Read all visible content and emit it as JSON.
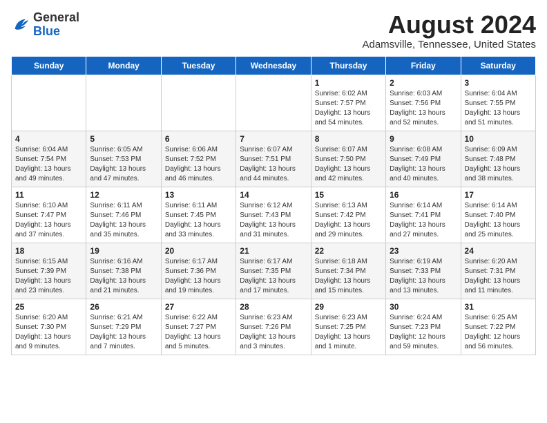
{
  "header": {
    "logo_general": "General",
    "logo_blue": "Blue",
    "month_title": "August 2024",
    "location": "Adamsville, Tennessee, United States"
  },
  "days_of_week": [
    "Sunday",
    "Monday",
    "Tuesday",
    "Wednesday",
    "Thursday",
    "Friday",
    "Saturday"
  ],
  "weeks": [
    [
      {
        "day": "",
        "info": ""
      },
      {
        "day": "",
        "info": ""
      },
      {
        "day": "",
        "info": ""
      },
      {
        "day": "",
        "info": ""
      },
      {
        "day": "1",
        "info": "Sunrise: 6:02 AM\nSunset: 7:57 PM\nDaylight: 13 hours\nand 54 minutes."
      },
      {
        "day": "2",
        "info": "Sunrise: 6:03 AM\nSunset: 7:56 PM\nDaylight: 13 hours\nand 52 minutes."
      },
      {
        "day": "3",
        "info": "Sunrise: 6:04 AM\nSunset: 7:55 PM\nDaylight: 13 hours\nand 51 minutes."
      }
    ],
    [
      {
        "day": "4",
        "info": "Sunrise: 6:04 AM\nSunset: 7:54 PM\nDaylight: 13 hours\nand 49 minutes."
      },
      {
        "day": "5",
        "info": "Sunrise: 6:05 AM\nSunset: 7:53 PM\nDaylight: 13 hours\nand 47 minutes."
      },
      {
        "day": "6",
        "info": "Sunrise: 6:06 AM\nSunset: 7:52 PM\nDaylight: 13 hours\nand 46 minutes."
      },
      {
        "day": "7",
        "info": "Sunrise: 6:07 AM\nSunset: 7:51 PM\nDaylight: 13 hours\nand 44 minutes."
      },
      {
        "day": "8",
        "info": "Sunrise: 6:07 AM\nSunset: 7:50 PM\nDaylight: 13 hours\nand 42 minutes."
      },
      {
        "day": "9",
        "info": "Sunrise: 6:08 AM\nSunset: 7:49 PM\nDaylight: 13 hours\nand 40 minutes."
      },
      {
        "day": "10",
        "info": "Sunrise: 6:09 AM\nSunset: 7:48 PM\nDaylight: 13 hours\nand 38 minutes."
      }
    ],
    [
      {
        "day": "11",
        "info": "Sunrise: 6:10 AM\nSunset: 7:47 PM\nDaylight: 13 hours\nand 37 minutes."
      },
      {
        "day": "12",
        "info": "Sunrise: 6:11 AM\nSunset: 7:46 PM\nDaylight: 13 hours\nand 35 minutes."
      },
      {
        "day": "13",
        "info": "Sunrise: 6:11 AM\nSunset: 7:45 PM\nDaylight: 13 hours\nand 33 minutes."
      },
      {
        "day": "14",
        "info": "Sunrise: 6:12 AM\nSunset: 7:43 PM\nDaylight: 13 hours\nand 31 minutes."
      },
      {
        "day": "15",
        "info": "Sunrise: 6:13 AM\nSunset: 7:42 PM\nDaylight: 13 hours\nand 29 minutes."
      },
      {
        "day": "16",
        "info": "Sunrise: 6:14 AM\nSunset: 7:41 PM\nDaylight: 13 hours\nand 27 minutes."
      },
      {
        "day": "17",
        "info": "Sunrise: 6:14 AM\nSunset: 7:40 PM\nDaylight: 13 hours\nand 25 minutes."
      }
    ],
    [
      {
        "day": "18",
        "info": "Sunrise: 6:15 AM\nSunset: 7:39 PM\nDaylight: 13 hours\nand 23 minutes."
      },
      {
        "day": "19",
        "info": "Sunrise: 6:16 AM\nSunset: 7:38 PM\nDaylight: 13 hours\nand 21 minutes."
      },
      {
        "day": "20",
        "info": "Sunrise: 6:17 AM\nSunset: 7:36 PM\nDaylight: 13 hours\nand 19 minutes."
      },
      {
        "day": "21",
        "info": "Sunrise: 6:17 AM\nSunset: 7:35 PM\nDaylight: 13 hours\nand 17 minutes."
      },
      {
        "day": "22",
        "info": "Sunrise: 6:18 AM\nSunset: 7:34 PM\nDaylight: 13 hours\nand 15 minutes."
      },
      {
        "day": "23",
        "info": "Sunrise: 6:19 AM\nSunset: 7:33 PM\nDaylight: 13 hours\nand 13 minutes."
      },
      {
        "day": "24",
        "info": "Sunrise: 6:20 AM\nSunset: 7:31 PM\nDaylight: 13 hours\nand 11 minutes."
      }
    ],
    [
      {
        "day": "25",
        "info": "Sunrise: 6:20 AM\nSunset: 7:30 PM\nDaylight: 13 hours\nand 9 minutes."
      },
      {
        "day": "26",
        "info": "Sunrise: 6:21 AM\nSunset: 7:29 PM\nDaylight: 13 hours\nand 7 minutes."
      },
      {
        "day": "27",
        "info": "Sunrise: 6:22 AM\nSunset: 7:27 PM\nDaylight: 13 hours\nand 5 minutes."
      },
      {
        "day": "28",
        "info": "Sunrise: 6:23 AM\nSunset: 7:26 PM\nDaylight: 13 hours\nand 3 minutes."
      },
      {
        "day": "29",
        "info": "Sunrise: 6:23 AM\nSunset: 7:25 PM\nDaylight: 13 hours\nand 1 minute."
      },
      {
        "day": "30",
        "info": "Sunrise: 6:24 AM\nSunset: 7:23 PM\nDaylight: 12 hours\nand 59 minutes."
      },
      {
        "day": "31",
        "info": "Sunrise: 6:25 AM\nSunset: 7:22 PM\nDaylight: 12 hours\nand 56 minutes."
      }
    ]
  ]
}
